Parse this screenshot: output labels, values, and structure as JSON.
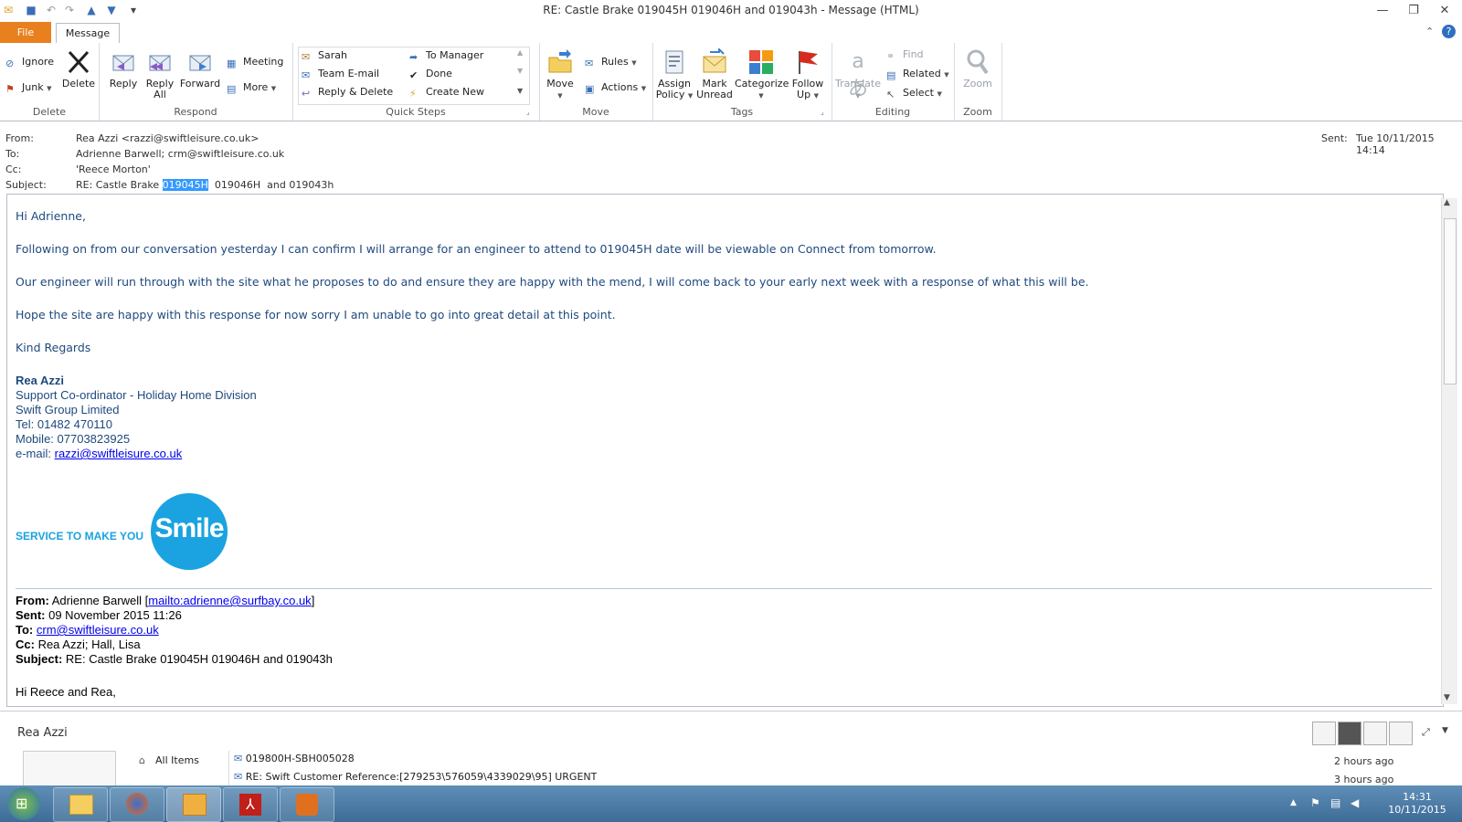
{
  "window": {
    "title": "RE: Castle Brake 019045H  019046H  and 019043h  -  Message (HTML)",
    "minimize": "—",
    "restore": "❐",
    "close": "✕"
  },
  "tabs": {
    "file": "File",
    "message": "Message"
  },
  "ribbon": {
    "delete_group": {
      "label": "Delete",
      "ignore": "Ignore",
      "junk": "Junk",
      "delete": "Delete"
    },
    "respond_group": {
      "label": "Respond",
      "reply": "Reply",
      "reply_all_1": "Reply",
      "reply_all_2": "All",
      "forward": "Forward",
      "meeting": "Meeting",
      "more": "More"
    },
    "quicksteps_group": {
      "label": "Quick Steps",
      "items": [
        "Sarah",
        "To Manager",
        "Team E-mail",
        "Done",
        "Reply & Delete",
        "Create New"
      ]
    },
    "move_group": {
      "label": "Move",
      "move": "Move",
      "rules": "Rules",
      "actions": "Actions"
    },
    "tags_group": {
      "label": "Tags",
      "assign_1": "Assign",
      "assign_2": "Policy",
      "mark_1": "Mark",
      "mark_2": "Unread",
      "categorize": "Categorize",
      "follow_1": "Follow",
      "follow_2": "Up"
    },
    "editing_group": {
      "label": "Editing",
      "translate": "Translate",
      "find": "Find",
      "related": "Related",
      "select": "Select"
    },
    "zoom_group": {
      "label": "Zoom",
      "zoom": "Zoom"
    }
  },
  "headers": {
    "from_label": "From:",
    "from_value": "Rea Azzi <razzi@swiftleisure.co.uk>",
    "to_label": "To:",
    "to_value": "Adrienne Barwell; crm@swiftleisure.co.uk",
    "cc_label": "Cc:",
    "cc_value": "'Reece Morton'",
    "subject_label": "Subject:",
    "subject_pre": "RE: Castle Brake ",
    "subject_hl": "019045H",
    "subject_post": "  019046H  and 019043h",
    "sent_label": "Sent:",
    "sent_value": "Tue 10/11/2015 14:14"
  },
  "body": {
    "greeting": "Hi Adrienne,",
    "p1": "Following on from our conversation yesterday I can confirm I will arrange for an engineer to attend to 019045H date will be viewable on Connect from tomorrow.",
    "p2": "Our engineer will run through with the site what he proposes to do and ensure they are happy with the mend, I will come back to your early next week with a response of what this will be.",
    "p3": "Hope the site are happy with this response for now sorry I am unable to go into great detail at this point.",
    "closing": "Kind Regards",
    "sig_name": "Rea Azzi",
    "sig_role": "Support Co-ordinator - Holiday Home Division",
    "sig_company": "Swift Group Limited",
    "sig_tel": "Tel: 01482 470110",
    "sig_mobile": "Mobile: 07703823925",
    "sig_email_label": "e-mail: ",
    "sig_email": "razzi@swiftleisure.co.uk",
    "logo_text": "SERVICE TO MAKE YOU",
    "logo_word": "Smile"
  },
  "original": {
    "from_label": "From:",
    "from_name": " Adrienne Barwell [",
    "from_link": "mailto:adrienne@surfbay.co.uk",
    "from_close": "]",
    "sent_label": "Sent:",
    "sent_value": " 09 November 2015 11:26",
    "to_label": "To:",
    "to_link": "crm@swiftleisure.co.uk",
    "cc_label": "Cc:",
    "cc_value": " Rea Azzi; Hall, Lisa",
    "subject_label": "Subject:",
    "subject_value": " RE: Castle Brake 019045H 019046H and 019043h",
    "greeting": "Hi Reece and Rea,"
  },
  "people_pane": {
    "name": "Rea Azzi",
    "all_items": "All Items",
    "items": [
      {
        "title": "019800H-SBH005028",
        "time": "2 hours ago"
      },
      {
        "title": "RE: Swift Customer Reference:[279253\\576059\\4339029\\95] URGENT",
        "time": "3 hours ago"
      }
    ]
  },
  "taskbar": {
    "time": "14:31",
    "date": "10/11/2015"
  },
  "colors": {
    "file_tab": "#e8801d",
    "body_text": "#1f497d",
    "logo_blue": "#1aa3e0",
    "taskbar": "#4a7aa5"
  }
}
